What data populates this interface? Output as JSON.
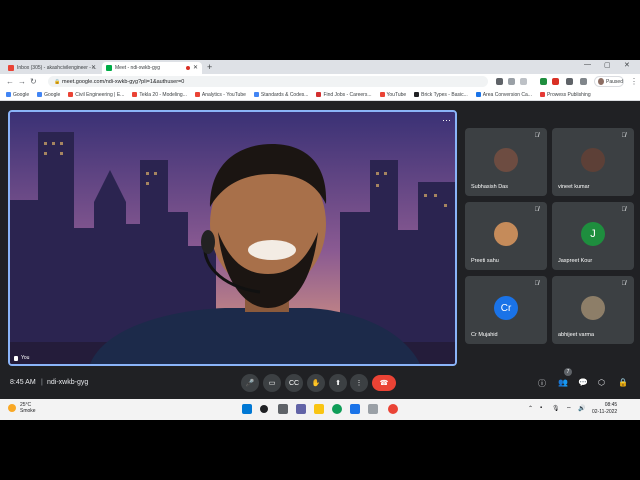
{
  "browser": {
    "tabs": [
      {
        "label": "Inbox (305) - akashcivilengineer - ...",
        "favicon_color": "#ea4335"
      },
      {
        "label": "Meet - ndi-xwkb-gyg",
        "favicon_color": "#00ac47"
      }
    ],
    "url": "meet.google.com/ndi-xwkb-gyg?pli=1&authuser=0",
    "profile_label": "Paused",
    "bookmarks": [
      {
        "label": "Google",
        "icon_color": "#4285f4"
      },
      {
        "label": "Google",
        "icon_color": "#4285f4"
      },
      {
        "label": "Civil Engineering | E...",
        "icon_color": "#ea4335"
      },
      {
        "label": "Tekla 20 - Modeling...",
        "icon_color": "#ea4335"
      },
      {
        "label": "Analytics - YouTube",
        "icon_color": "#ea4335"
      },
      {
        "label": "Standards & Codes...",
        "icon_color": "#4285f4"
      },
      {
        "label": "Find Jobs - Careers...",
        "icon_color": "#d32f2f"
      },
      {
        "label": "YouTube",
        "icon_color": "#ea4335"
      },
      {
        "label": "Brick Types - Basic...",
        "icon_color": "#202124"
      },
      {
        "label": "Area Conversion Ca...",
        "icon_color": "#1a73e8"
      },
      {
        "label": "Prowess Publishing",
        "icon_color": "#e53935"
      }
    ]
  },
  "meeting": {
    "main_label": "You",
    "participants": [
      {
        "name": "Subhasish Das",
        "type": "photo",
        "color": "#6d4c41"
      },
      {
        "name": "vineet kumar",
        "type": "photo",
        "color": "#5d4037"
      },
      {
        "name": "Preeti sahu",
        "type": "photo",
        "color": "#c58b5a"
      },
      {
        "name": "Jaspreet Kour",
        "type": "letter",
        "letter": "J",
        "color": "#1e8e3e"
      },
      {
        "name": "Cr Mujahid",
        "type": "letter",
        "letter": "Cr",
        "color": "#1a73e8"
      },
      {
        "name": "abhijeet varma",
        "type": "photo",
        "color": "#8d7e68"
      }
    ],
    "time": "8:45 AM",
    "separator": "|",
    "code": "ndi-xwkb-gyg",
    "people_count": "7",
    "end_call_color": "#ea4335"
  },
  "taskbar": {
    "temperature": "25°C",
    "weather": "Smoke",
    "clock_time": "08:45",
    "clock_date": "02-11-2022"
  }
}
